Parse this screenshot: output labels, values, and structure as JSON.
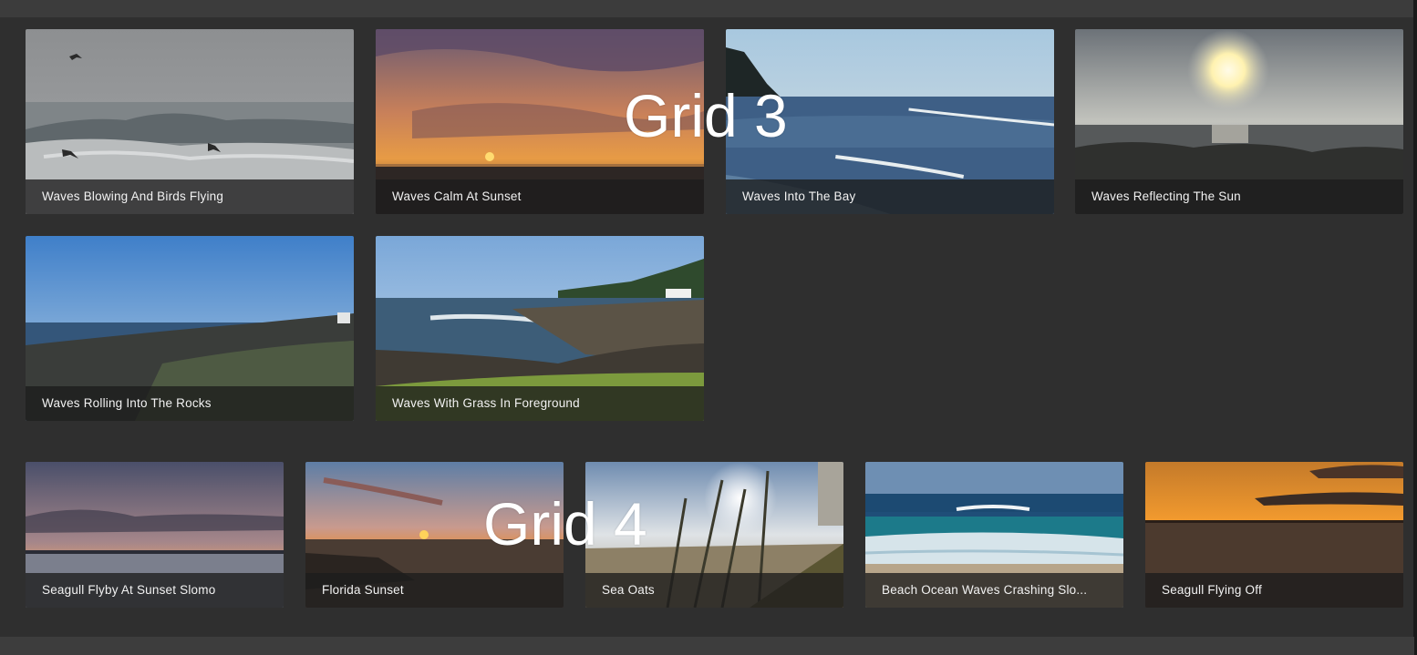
{
  "overlays": {
    "grid3_label": "Grid 3",
    "grid4_label": "Grid 4"
  },
  "grid3": {
    "items": [
      {
        "title": "Waves Blowing And Birds Flying"
      },
      {
        "title": "Waves Calm At Sunset"
      },
      {
        "title": "Waves Into The Bay"
      },
      {
        "title": "Waves Reflecting The Sun"
      },
      {
        "title": "Waves Rolling Into The Rocks"
      },
      {
        "title": "Waves With Grass In Foreground"
      }
    ]
  },
  "grid4": {
    "items": [
      {
        "title": "Seagull Flyby At Sunset Slomo"
      },
      {
        "title": "Florida Sunset"
      },
      {
        "title": "Sea Oats"
      },
      {
        "title": "Beach Ocean Waves Crashing Slo..."
      },
      {
        "title": "Seagull Flying Off"
      }
    ]
  },
  "colors": {
    "panel": "#2f2f2f",
    "frame": "#3c3c3c",
    "caption_bg": "#1c1c1c",
    "caption_text": "#f2f2f2"
  }
}
